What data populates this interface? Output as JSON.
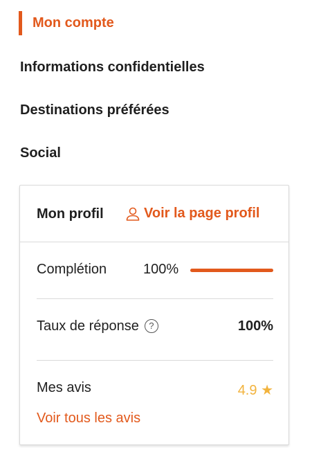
{
  "nav": {
    "active_label": "Mon compte",
    "items": [
      {
        "label": "Informations confidentielles"
      },
      {
        "label": "Destinations préférées"
      },
      {
        "label": "Social"
      }
    ]
  },
  "profile_card": {
    "title": "Mon profil",
    "profile_link_label": "Voir la page profil",
    "profile_link_icon": "user-icon",
    "completion": {
      "label": "Complétion",
      "value_text": "100%",
      "progress_fraction": 1.0
    },
    "response_rate": {
      "label": "Taux de réponse",
      "help_icon": "question-circle-icon",
      "help_glyph": "?",
      "value": "100%"
    },
    "reviews": {
      "label": "Mes avis",
      "rating": "4.9",
      "star_glyph": "★",
      "star_icon": "star-icon",
      "see_all_label": "Voir tous les avis"
    }
  },
  "colors": {
    "accent": "#e2591c",
    "rating": "#f2b33d",
    "text": "#1f1f1f",
    "border": "#d9d9d9"
  }
}
